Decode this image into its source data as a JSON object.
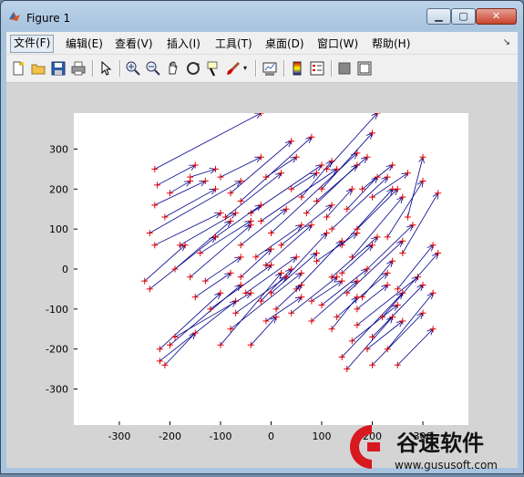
{
  "window": {
    "title": "Figure 1",
    "min": "▁",
    "max": "▢",
    "close": "✕"
  },
  "menubar": {
    "items": [
      "文件(F)",
      "编辑(E)",
      "查看(V)",
      "插入(I)",
      "工具(T)",
      "桌面(D)",
      "窗口(W)",
      "帮助(H)"
    ],
    "dock": "↘"
  },
  "toolbar": {
    "icons": [
      "new-figure-icon",
      "open-icon",
      "save-icon",
      "print-icon",
      "pointer-icon",
      "zoom-in-icon",
      "zoom-out-icon",
      "pan-icon",
      "rotate-3d-icon",
      "data-cursor-icon",
      "brush-icon",
      "link-plot-icon",
      "colorbar-icon",
      "legend-icon",
      "hide-plot-tools-icon",
      "show-plot-tools-icon"
    ]
  },
  "chart_data": {
    "type": "quiver",
    "xlim": [
      -390,
      390
    ],
    "ylim": [
      -390,
      390
    ],
    "x_ticks": [
      -300,
      -200,
      -100,
      0,
      100,
      200,
      300
    ],
    "y_ticks": [
      -300,
      -200,
      -100,
      0,
      100,
      200,
      300
    ],
    "x_tick_labels": [
      "-300",
      "-200",
      "-100",
      "0",
      "100",
      "200",
      "300"
    ],
    "y_tick_labels": [
      "-300",
      "-200",
      "-100",
      "0",
      "100",
      "200",
      "300"
    ],
    "arrow_color": "#00008b",
    "point_color": "#e00000",
    "vectors": [
      [
        -230,
        250,
        -20,
        390
      ],
      [
        -225,
        210,
        -150,
        260
      ],
      [
        -200,
        190,
        -160,
        220
      ],
      [
        -230,
        160,
        -130,
        220
      ],
      [
        -210,
        130,
        -110,
        200
      ],
      [
        -240,
        90,
        -60,
        220
      ],
      [
        -230,
        60,
        -100,
        140
      ],
      [
        -250,
        -30,
        -170,
        60
      ],
      [
        -240,
        -50,
        -110,
        80
      ],
      [
        -180,
        60,
        -70,
        140
      ],
      [
        -190,
        0,
        -80,
        120
      ],
      [
        -160,
        -20,
        -40,
        110
      ],
      [
        -220,
        -200,
        -100,
        -60
      ],
      [
        -220,
        -230,
        -70,
        -80
      ],
      [
        -200,
        -190,
        -60,
        -40
      ],
      [
        -190,
        -170,
        -40,
        -60
      ],
      [
        -210,
        -240,
        -150,
        -160
      ],
      [
        -100,
        -190,
        20,
        -10
      ],
      [
        -40,
        -190,
        10,
        -120
      ],
      [
        -80,
        -150,
        60,
        -10
      ],
      [
        -120,
        -100,
        0,
        10
      ],
      [
        -50,
        -60,
        50,
        30
      ],
      [
        -70,
        -110,
        30,
        -20
      ],
      [
        -20,
        -80,
        40,
        0
      ],
      [
        -100,
        230,
        -20,
        280
      ],
      [
        -80,
        190,
        40,
        320
      ],
      [
        -60,
        170,
        80,
        330
      ],
      [
        -40,
        140,
        100,
        260
      ],
      [
        -20,
        120,
        130,
        250
      ],
      [
        0,
        90,
        170,
        290
      ],
      [
        -90,
        130,
        20,
        240
      ],
      [
        -110,
        80,
        -20,
        160
      ],
      [
        -140,
        40,
        -40,
        120
      ],
      [
        -60,
        60,
        30,
        150
      ],
      [
        -30,
        30,
        60,
        110
      ],
      [
        -10,
        10,
        80,
        110
      ],
      [
        20,
        60,
        120,
        160
      ],
      [
        30,
        -20,
        110,
        90
      ],
      [
        50,
        -50,
        140,
        70
      ],
      [
        0,
        -60,
        90,
        40
      ],
      [
        40,
        -110,
        130,
        -20
      ],
      [
        10,
        -100,
        60,
        -40
      ],
      [
        70,
        140,
        170,
        260
      ],
      [
        100,
        200,
        200,
        340
      ],
      [
        90,
        170,
        190,
        280
      ],
      [
        120,
        100,
        230,
        230
      ],
      [
        140,
        60,
        240,
        200
      ],
      [
        160,
        30,
        260,
        180
      ],
      [
        190,
        0,
        280,
        110
      ],
      [
        120,
        -20,
        210,
        80
      ],
      [
        150,
        -60,
        260,
        70
      ],
      [
        100,
        -90,
        190,
        0
      ],
      [
        80,
        -130,
        170,
        -30
      ],
      [
        130,
        -120,
        230,
        -10
      ],
      [
        170,
        -140,
        290,
        -20
      ],
      [
        200,
        -170,
        300,
        -40
      ],
      [
        160,
        -180,
        250,
        -90
      ],
      [
        140,
        -220,
        260,
        -60
      ],
      [
        150,
        -250,
        240,
        -120
      ],
      [
        200,
        -240,
        300,
        -110
      ],
      [
        230,
        -200,
        320,
        -60
      ],
      [
        250,
        -240,
        320,
        -150
      ],
      [
        220,
        -120,
        330,
        40
      ],
      [
        250,
        -50,
        320,
        60
      ],
      [
        260,
        40,
        330,
        190
      ],
      [
        230,
        80,
        300,
        220
      ],
      [
        270,
        130,
        300,
        280
      ],
      [
        200,
        180,
        270,
        240
      ],
      [
        170,
        100,
        250,
        200
      ],
      [
        180,
        200,
        240,
        260
      ],
      [
        150,
        150,
        210,
        230
      ],
      [
        110,
        130,
        160,
        200
      ],
      [
        140,
        -10,
        200,
        60
      ],
      [
        180,
        -70,
        240,
        20
      ],
      [
        120,
        -150,
        170,
        -70
      ],
      [
        170,
        -100,
        230,
        -40
      ],
      [
        60,
        180,
        120,
        270
      ],
      [
        -10,
        230,
        50,
        280
      ],
      [
        -160,
        230,
        -110,
        250
      ],
      [
        40,
        200,
        90,
        240
      ],
      [
        110,
        250,
        210,
        390
      ],
      [
        -130,
        -30,
        -60,
        30
      ],
      [
        -150,
        -70,
        -80,
        -10
      ],
      [
        -60,
        -20,
        0,
        50
      ],
      [
        -10,
        -130,
        60,
        -70
      ],
      [
        80,
        -80,
        140,
        -30
      ],
      [
        190,
        -200,
        260,
        -130
      ],
      [
        90,
        20,
        170,
        90
      ]
    ]
  },
  "watermark": {
    "brand": "谷速软件",
    "url": "www.gususoft.com"
  }
}
